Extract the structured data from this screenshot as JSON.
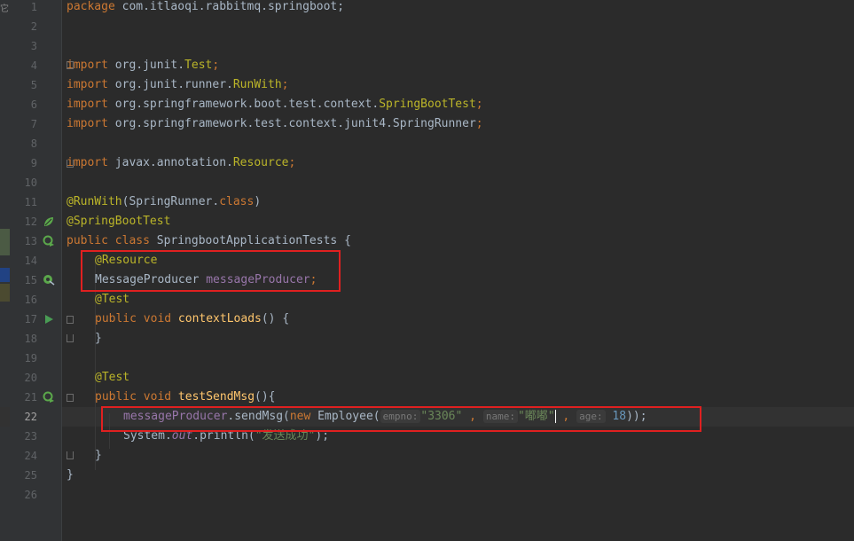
{
  "colors": {
    "keyword": "#cc7832",
    "annotation": "#bbb529",
    "field": "#9876aa",
    "string": "#6a8759",
    "number": "#6897bb",
    "method": "#ffc66d",
    "plain": "#a9b7c6",
    "highlight_box": "#e02020",
    "background": "#2b2b2b"
  },
  "edge": {
    "char": "它"
  },
  "gutter": {
    "line_numbers": [
      "1",
      "2",
      "3",
      "4",
      "5",
      "6",
      "7",
      "8",
      "9",
      "10",
      "11",
      "12",
      "13",
      "14",
      "15",
      "16",
      "17",
      "18",
      "19",
      "20",
      "21",
      "22",
      "23",
      "24",
      "25",
      "26"
    ],
    "icons": {
      "l12": "spring-bean-icon",
      "l13": "run-test-class-icon",
      "l15": "injection-point-icon",
      "l17": "run-test-icon",
      "l21": "run-test-method-icon"
    }
  },
  "code": {
    "l1": {
      "kw": "package",
      "rest": " com.itlaoqi.rabbitmq.springboot;"
    },
    "l4": {
      "kw": "import",
      "pkg": " org.junit.",
      "cls": "Test",
      "end": ";"
    },
    "l5": {
      "kw": "import",
      "pkg": " org.junit.runner.",
      "cls": "RunWith",
      "end": ";"
    },
    "l6": {
      "kw": "import",
      "pkg": " org.springframework.boot.test.context.",
      "cls": "SpringBootTest",
      "end": ";"
    },
    "l7": {
      "kw": "import",
      "pkg": " org.springframework.test.context.junit4.SpringRunner",
      "end": ";"
    },
    "l9": {
      "kw": "import",
      "pkg": " javax.annotation.",
      "cls": "Resource",
      "end": ";"
    },
    "l11": {
      "ann": "@RunWith",
      "p1": "(SpringRunner.",
      "kw2": "class",
      "p2": ")"
    },
    "l12": {
      "ann": "@SpringBootTest"
    },
    "l13": {
      "kw": "public class",
      "name": " SpringbootApplicationTests {"
    },
    "l14": {
      "ann": "@Resource"
    },
    "l15": {
      "type": "MessageProducer ",
      "field": "messageProducer",
      "end": ";"
    },
    "l16": {
      "ann": "@Test"
    },
    "l17": {
      "kw": "public void",
      "fn": "contextLoads",
      "rest": "() {"
    },
    "l18": {
      "text": "}"
    },
    "l20": {
      "ann": "@Test"
    },
    "l21": {
      "kw": "public void",
      "fn": "testSendMsg",
      "rest": "(){"
    },
    "l22": {
      "field": "messageProducer",
      "call": ".sendMsg(",
      "kw": "new",
      "cls": " Employee(",
      "hint_empno": "empno:",
      "val_empno": "\"3306\"",
      "comma1": " , ",
      "hint_name": "name:",
      "val_name": "\"嘟嘟\"",
      "comma2": " , ",
      "hint_age": "age:",
      "val_age": "18",
      "end": "));"
    },
    "l23": {
      "pre": "System.",
      "out": "out",
      "mid": ".println(",
      "str": "\"发送成功\"",
      "end": ");"
    },
    "l24": {
      "text": "}"
    },
    "l25": {
      "text": "}"
    }
  }
}
